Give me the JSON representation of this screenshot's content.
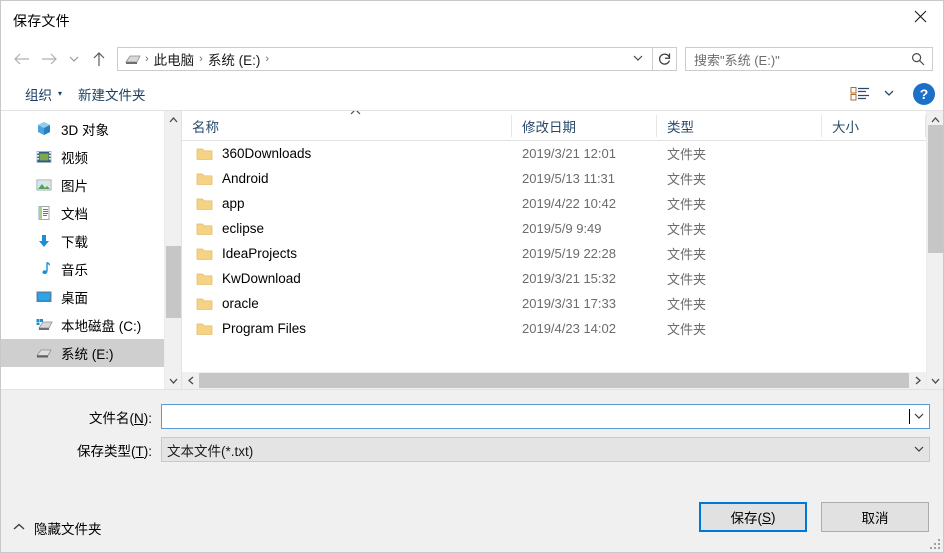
{
  "window": {
    "title": "保存文件",
    "close_icon": "close-icon"
  },
  "address_bar": {
    "back_icon": "arrow-left-icon",
    "forward_icon": "arrow-right-icon",
    "recent_icon": "chevron-down-icon",
    "up_icon": "arrow-up-icon",
    "drive_icon": "drive-icon",
    "breadcrumbs": [
      "此电脑",
      "系统 (E:)"
    ],
    "separator": "›",
    "dropdown_icon": "chevron-down-icon",
    "refresh_icon": "refresh-icon"
  },
  "search": {
    "placeholder": "搜索\"系统 (E:)\"",
    "icon": "search-icon"
  },
  "command_bar": {
    "organize_label": "组织",
    "organize_caret": "▾",
    "new_folder_label": "新建文件夹",
    "view_icon": "view-layout-icon",
    "view_caret": "▾",
    "help_label": "?"
  },
  "tree": {
    "items": [
      {
        "label": "3D 对象",
        "icon": "3d-objects-icon",
        "selected": false
      },
      {
        "label": "视频",
        "icon": "videos-icon",
        "selected": false
      },
      {
        "label": "图片",
        "icon": "pictures-icon",
        "selected": false
      },
      {
        "label": "文档",
        "icon": "documents-icon",
        "selected": false
      },
      {
        "label": "下载",
        "icon": "downloads-icon",
        "selected": false
      },
      {
        "label": "音乐",
        "icon": "music-icon",
        "selected": false
      },
      {
        "label": "桌面",
        "icon": "desktop-icon",
        "selected": false
      },
      {
        "label": "本地磁盘 (C:)",
        "icon": "local-disk-icon",
        "selected": false
      },
      {
        "label": "系统 (E:)",
        "icon": "drive-icon",
        "selected": true
      }
    ],
    "scroll_up_icon": "chevron-up-icon",
    "scroll_down_icon": "chevron-down-icon"
  },
  "file_list": {
    "columns": [
      "名称",
      "修改日期",
      "类型",
      "大小"
    ],
    "sort_column": "名称",
    "sort_indicator": "▲",
    "rows": [
      {
        "name": "360Downloads",
        "date": "2019/3/21 12:01",
        "type": "文件夹",
        "size": ""
      },
      {
        "name": "Android",
        "date": "2019/5/13 11:31",
        "type": "文件夹",
        "size": ""
      },
      {
        "name": "app",
        "date": "2019/4/22 10:42",
        "type": "文件夹",
        "size": ""
      },
      {
        "name": "eclipse",
        "date": "2019/5/9 9:49",
        "type": "文件夹",
        "size": ""
      },
      {
        "name": "IdeaProjects",
        "date": "2019/5/19 22:28",
        "type": "文件夹",
        "size": ""
      },
      {
        "name": "KwDownload",
        "date": "2019/3/21 15:32",
        "type": "文件夹",
        "size": ""
      },
      {
        "name": "oracle",
        "date": "2019/3/31 17:33",
        "type": "文件夹",
        "size": ""
      },
      {
        "name": "Program Files",
        "date": "2019/4/23 14:02",
        "type": "文件夹",
        "size": ""
      }
    ],
    "scroll_up_icon": "chevron-up-icon",
    "scroll_down_icon": "chevron-down-icon",
    "scroll_left_icon": "chevron-left-icon",
    "scroll_right_icon": "chevron-right-icon"
  },
  "form": {
    "filename_label_pre": "文件名(",
    "filename_label_key": "N",
    "filename_label_post": "):",
    "filename_value": "",
    "filename_dropdown_icon": "chevron-down-icon",
    "filetype_label_pre": "保存类型(",
    "filetype_label_key": "T",
    "filetype_label_post": "):",
    "filetype_value": "文本文件(*.txt)",
    "filetype_dropdown_icon": "chevron-down-icon"
  },
  "footer": {
    "hide_folders_label": "隐藏文件夹",
    "hide_folders_icon": "chevron-up-icon",
    "save_label_pre": "保存(",
    "save_label_key": "S",
    "save_label_post": ")",
    "cancel_label": "取消",
    "resize_grip_icon": "resize-grip-icon"
  },
  "colors": {
    "accent": "#0078d7",
    "focus_border": "#5b9bd5",
    "command_text": "#1c3f66",
    "header_text": "#2b4a6b",
    "muted_text": "#6c6c6c",
    "folder_yellow": "#f7d08a",
    "selection": "#cfcfcf"
  }
}
